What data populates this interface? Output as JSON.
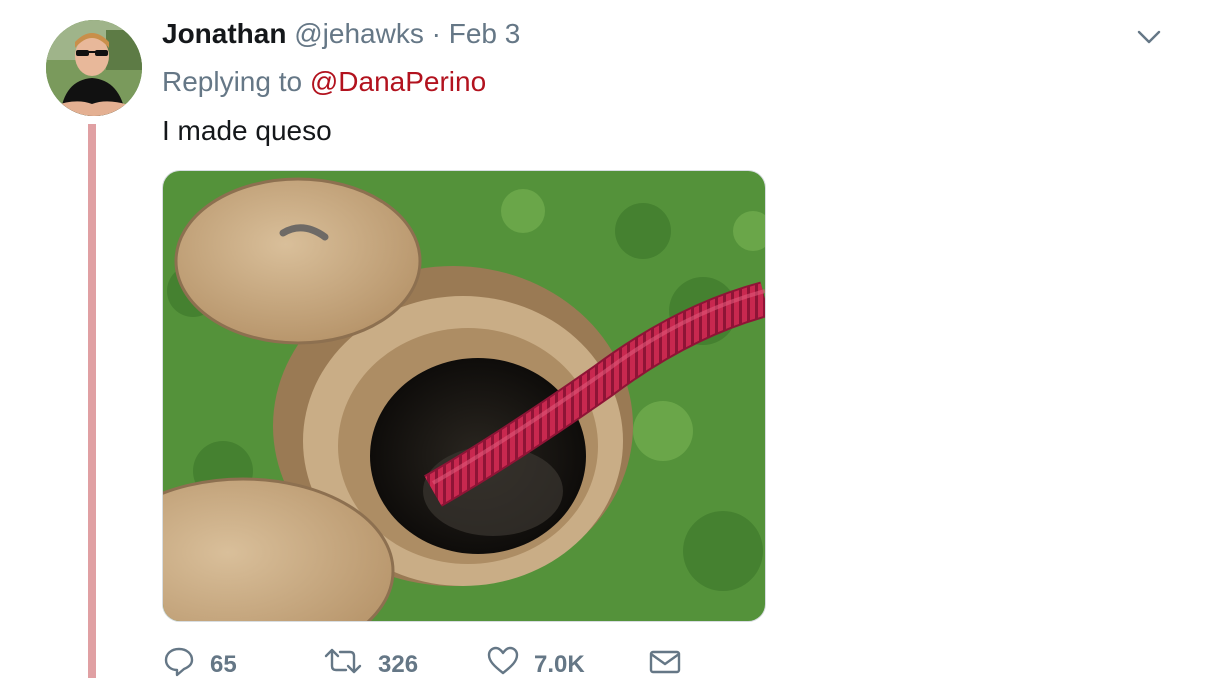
{
  "tweet": {
    "author_name": "Jonathan",
    "author_handle": "@jehawks",
    "separator": "·",
    "date": "Feb 3",
    "replying_prefix": "Replying to",
    "replying_to": "@DanaPerino",
    "text": "I made queso"
  },
  "actions": {
    "replies": "65",
    "retweets": "326",
    "likes": "7.0K"
  },
  "icons": {
    "more": "chevron-down-icon",
    "reply": "reply-icon",
    "retweet": "retweet-icon",
    "like": "heart-icon",
    "message": "envelope-icon"
  },
  "colors": {
    "mention": "#b2121e",
    "thread_line": "#e0a0a3",
    "muted_text": "#657786",
    "primary_text": "#14171a"
  }
}
